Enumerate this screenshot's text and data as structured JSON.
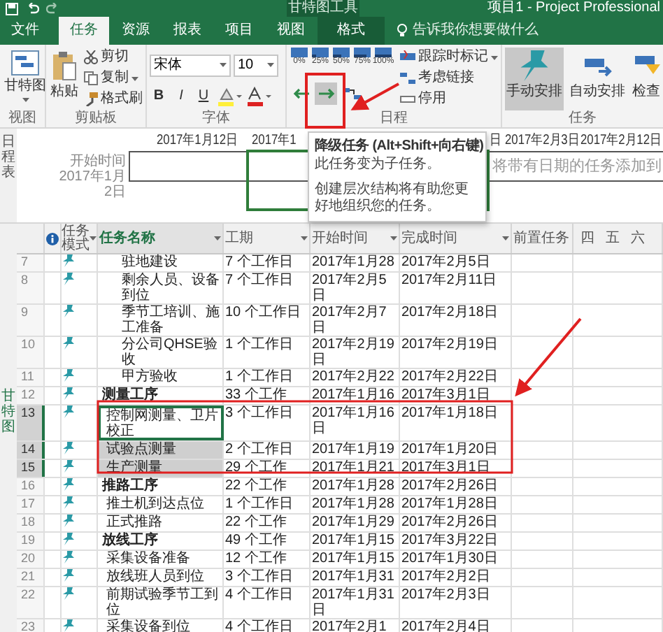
{
  "title_bar": {
    "context": "甘特图工具",
    "title": "项目1 - Project Professional"
  },
  "tabs": [
    {
      "label": "文件",
      "selected": false,
      "kind": "file"
    },
    {
      "label": "任务",
      "selected": true,
      "kind": "normal"
    },
    {
      "label": "资源",
      "selected": false,
      "kind": "normal"
    },
    {
      "label": "报表",
      "selected": false,
      "kind": "normal"
    },
    {
      "label": "项目",
      "selected": false,
      "kind": "normal"
    },
    {
      "label": "视图",
      "selected": false,
      "kind": "normal"
    },
    {
      "label": "格式",
      "selected": false,
      "kind": "contextual"
    }
  ],
  "tell_me": {
    "placeholder": "告诉我你想要做什么"
  },
  "ribbon": {
    "view": {
      "button": "甘特图",
      "group": "视图"
    },
    "clipboard": {
      "paste": "粘贴",
      "cut": "剪切",
      "copy": "复制",
      "format_painter": "格式刷",
      "group": "剪贴板"
    },
    "font": {
      "name": "宋体",
      "size": "10",
      "bold": "B",
      "italic": "I",
      "underline": "U",
      "group": "字体"
    },
    "schedule": {
      "percents": [
        "0%",
        "25%",
        "50%",
        "75%",
        "100%"
      ],
      "mark_on_track": "跟踪时标记",
      "respect_links": "考虑链接",
      "inactivate": "停用",
      "group": "日程"
    },
    "tasks": {
      "manual": {
        "label": "手动安排",
        "selected": true
      },
      "auto": {
        "label": "自动安排",
        "selected": false
      },
      "inspect": "检查",
      "group": "任务"
    }
  },
  "timeline": {
    "label": "日程表",
    "start_label": "开始时间",
    "start_date": "2017年1月2日",
    "ticks": [
      "2017年1月12日",
      "2017年1",
      "日",
      "2017年2月3日",
      "2017年2月12日"
    ],
    "placeholder": "将带有日期的任务添加到"
  },
  "tooltip": {
    "title": "降级任务 (Alt+Shift+向右键)",
    "lines": [
      "此任务变为子任务。",
      "创建层次结构将有助您更好地组织您的任务。"
    ]
  },
  "grid": {
    "side_label": "甘特图",
    "columns": {
      "mode": "任务模式",
      "name": "任务名称",
      "duration": "工期",
      "start": "开始时间",
      "finish": "完成时间",
      "predecessors": "前置任务"
    },
    "gantt_days": [
      "四",
      "五",
      "六"
    ],
    "rows": [
      {
        "children": [
          {
            "id": "7",
            "name": "驻地建设",
            "duration": "7 个工作日",
            "start": "2017年1月28",
            "finish": "2017年2月5日",
            "summary": false,
            "selected": false,
            "focused": false
          },
          {
            "id": "8",
            "name": "剩余人员、设备到位",
            "duration": "7 个工作日",
            "start": "2017年2月5日",
            "finish": "2017年2月11日",
            "summary": false,
            "selected": false,
            "focused": false
          },
          {
            "id": "9",
            "name": "季节工培训、施工准备",
            "duration": "10 个工作日",
            "start": "2017年2月7日",
            "finish": "2017年2月18日",
            "summary": false,
            "selected": false,
            "focused": false
          },
          {
            "id": "10",
            "name": "分公司QHSE验收",
            "duration": "1 个工作日",
            "start": "2017年2月19日",
            "finish": "2017年2月19日",
            "summary": false,
            "selected": false,
            "focused": false
          },
          {
            "id": "11",
            "name": "甲方验收",
            "duration": "1 个工作日",
            "start": "2017年2月22",
            "finish": "2017年2月22日",
            "summary": false,
            "selected": false,
            "focused": false
          }
        ]
      },
      {
        "id": "12",
        "name": "测量工序",
        "duration": "33 个工作",
        "start": "2017年1月16",
        "finish": "2017年3月1日",
        "summary": true,
        "selected": false,
        "focused": false,
        "children": [
          {
            "id": "13",
            "name": "控制网测量、卫片校正",
            "duration": "3 个工作日",
            "start": "2017年1月16日",
            "finish": "2017年1月18日",
            "summary": false,
            "selected": true,
            "focused": true
          },
          {
            "id": "14",
            "name": "试验点测量",
            "duration": "2 个工作日",
            "start": "2017年1月19",
            "finish": "2017年1月20日",
            "summary": false,
            "selected": true,
            "focused": false
          },
          {
            "id": "15",
            "name": "生产测量",
            "duration": "29 个工作",
            "start": "2017年1月21",
            "finish": "2017年3月1日",
            "summary": false,
            "selected": true,
            "focused": false
          }
        ]
      },
      {
        "id": "16",
        "name": "推路工序",
        "duration": "22 个工作",
        "start": "2017年1月28",
        "finish": "2017年2月26日",
        "summary": true,
        "selected": false,
        "focused": false,
        "children": [
          {
            "id": "17",
            "name": "推土机到达点位",
            "duration": "1 个工作日",
            "start": "2017年1月28",
            "finish": "2017年1月28日",
            "summary": false,
            "selected": false,
            "focused": false
          },
          {
            "id": "18",
            "name": "正式推路",
            "duration": "22 个工作",
            "start": "2017年1月29",
            "finish": "2017年2月26日",
            "summary": false,
            "selected": false,
            "focused": false
          }
        ]
      },
      {
        "id": "19",
        "name": "放线工序",
        "duration": "49 个工作",
        "start": "2017年1月15",
        "finish": "2017年3月22日",
        "summary": true,
        "selected": false,
        "focused": false,
        "children": [
          {
            "id": "20",
            "name": "采集设备准备",
            "duration": "12 个工作",
            "start": "2017年1月15",
            "finish": "2017年1月30日",
            "summary": false,
            "selected": false,
            "focused": false
          },
          {
            "id": "21",
            "name": "放线班人员到位",
            "duration": "3 个工作日",
            "start": "2017年1月31",
            "finish": "2017年2月2日",
            "summary": false,
            "selected": false,
            "focused": false
          },
          {
            "id": "22",
            "name": "前期试验季节工到位",
            "duration": "4 个工作日",
            "start": "2017年1月31日",
            "finish": "2017年2月3日",
            "summary": false,
            "selected": false,
            "focused": false
          },
          {
            "id": "23",
            "name": "采集设备到位",
            "duration": "4 个工作日",
            "start": "2017年2月1",
            "finish": "2017年2月4日",
            "summary": false,
            "selected": false,
            "focused": false
          }
        ]
      }
    ]
  }
}
